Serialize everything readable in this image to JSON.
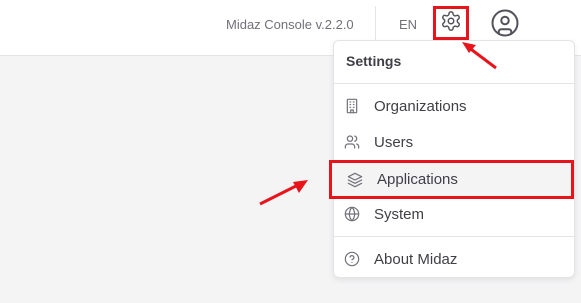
{
  "header": {
    "version": "Midaz Console v.2.2.0",
    "language": "EN",
    "settings_icon": "gear-icon",
    "avatar_icon": "user-circle-icon"
  },
  "settings_menu": {
    "title": "Settings",
    "items": [
      {
        "label": "Organizations",
        "icon": "building-icon"
      },
      {
        "label": "Users",
        "icon": "users-icon"
      },
      {
        "label": "Applications",
        "icon": "layers-icon",
        "highlighted": true
      },
      {
        "label": "System",
        "icon": "globe-icon"
      },
      {
        "label": "About Midaz",
        "icon": "help-circle-icon"
      }
    ]
  },
  "colors": {
    "highlight": "#e8141c",
    "background": "#f4f4f5",
    "text": "#3f3f46"
  }
}
